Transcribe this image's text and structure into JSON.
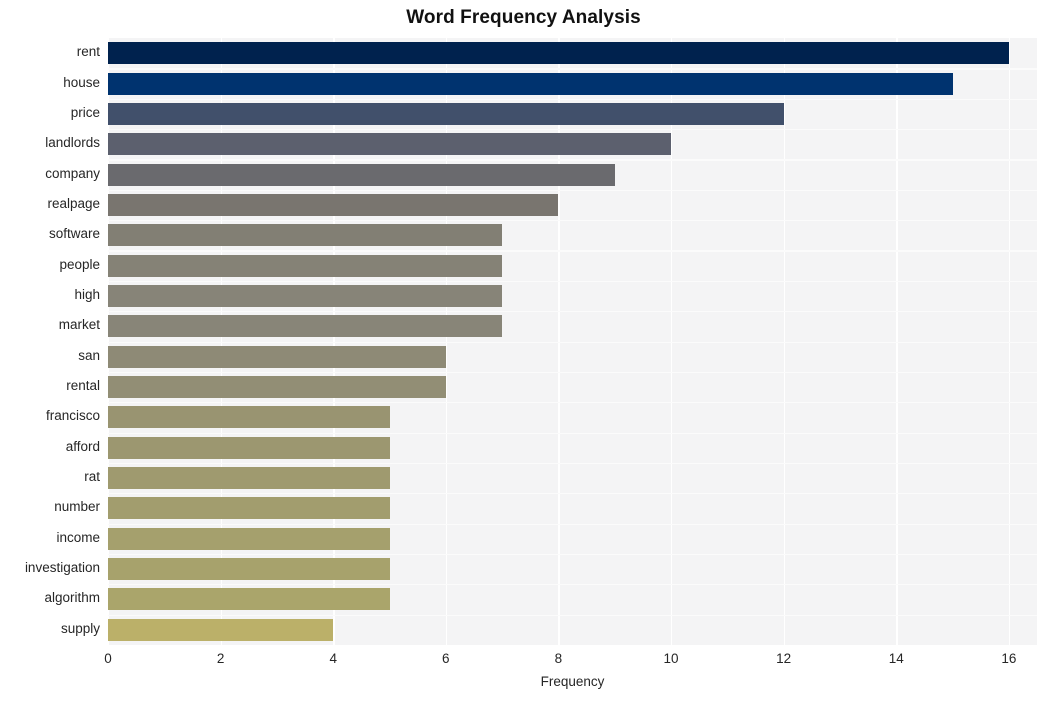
{
  "chart_data": {
    "type": "bar",
    "orientation": "horizontal",
    "title": "Word Frequency Analysis",
    "xlabel": "Frequency",
    "ylabel": "",
    "xlim": [
      0,
      16.5
    ],
    "xticks": [
      0,
      2,
      4,
      6,
      8,
      10,
      12,
      14,
      16
    ],
    "xticklabels": [
      "0",
      "2",
      "4",
      "6",
      "8",
      "10",
      "12",
      "14",
      "16"
    ],
    "grid": true,
    "legend": null,
    "categories": [
      "rent",
      "house",
      "price",
      "landlords",
      "company",
      "realpage",
      "software",
      "people",
      "high",
      "market",
      "san",
      "rental",
      "francisco",
      "afford",
      "rat",
      "number",
      "income",
      "investigation",
      "algorithm",
      "supply"
    ],
    "values": [
      16,
      15,
      12,
      10,
      9,
      8,
      7,
      7,
      7,
      7,
      6,
      6,
      5,
      5,
      5,
      5,
      5,
      5,
      5,
      4
    ],
    "bar_colors": [
      "#00224e",
      "#00336f",
      "#41506b",
      "#5c606e",
      "#6a6a6e",
      "#79756f",
      "#827f74",
      "#858276",
      "#878478",
      "#888578",
      "#8e8a76",
      "#928e75",
      "#999471",
      "#9c9770",
      "#9f9a6f",
      "#a29d6e",
      "#a5a06d",
      "#a7a26c",
      "#aaa56b",
      "#bbb069"
    ],
    "plot_background": "#f4f4f5",
    "figure_background": "#ffffff",
    "gridline_color": "#ffffff"
  }
}
